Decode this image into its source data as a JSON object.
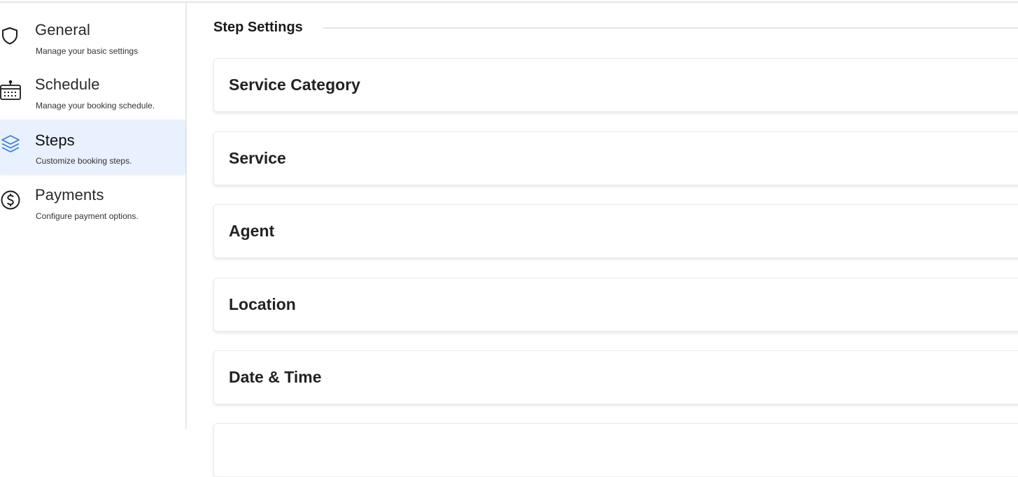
{
  "sidebar": {
    "items": [
      {
        "title": "General",
        "subtitle": "Manage your basic settings",
        "icon": "shield-icon",
        "active": false
      },
      {
        "title": "Schedule",
        "subtitle": "Manage your booking schedule.",
        "icon": "calendar-icon",
        "active": false
      },
      {
        "title": "Steps",
        "subtitle": "Customize booking steps.",
        "icon": "layers-icon",
        "active": true
      },
      {
        "title": "Payments",
        "subtitle": "Configure payment options.",
        "icon": "dollar-circle-icon",
        "active": false
      }
    ]
  },
  "main": {
    "section_title": "Step Settings",
    "steps": [
      {
        "label": "Service Category"
      },
      {
        "label": "Service"
      },
      {
        "label": "Agent"
      },
      {
        "label": "Location"
      },
      {
        "label": "Date & Time"
      }
    ]
  },
  "colors": {
    "active_bg": "#e8f1fd",
    "active_icon": "#3b7ddd",
    "text": "#1f1f1f"
  }
}
